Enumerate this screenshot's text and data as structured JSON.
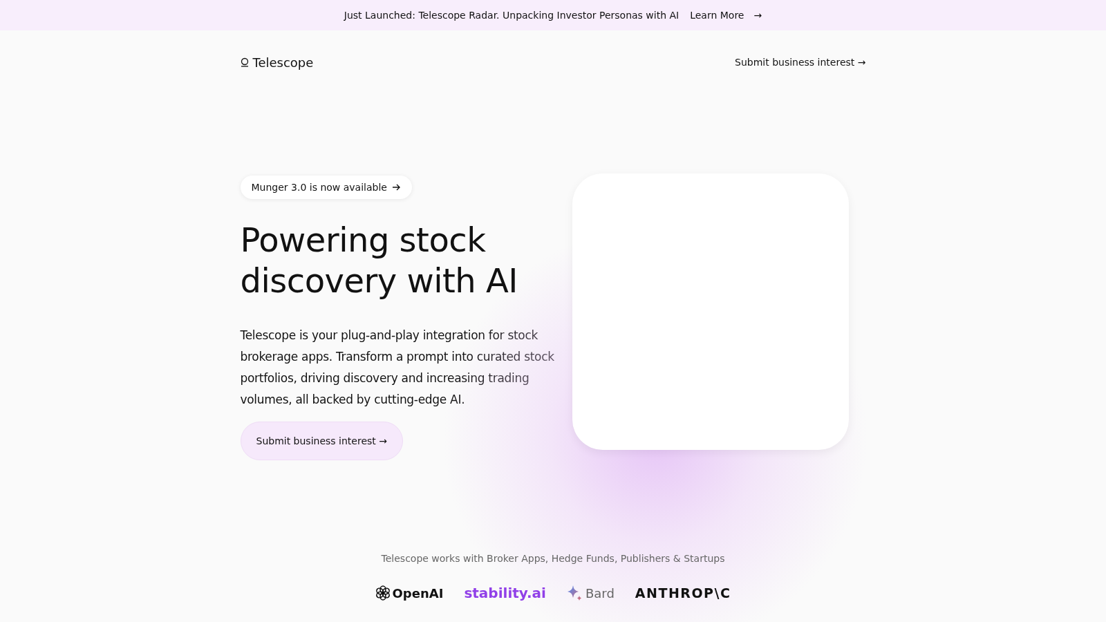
{
  "announcement": {
    "text": "Just Launched: Telescope Radar. Unpacking Investor Personas with AI",
    "link": "Learn More",
    "arrow": "→"
  },
  "nav": {
    "brand": "Telescope",
    "cta": "Submit business interest →"
  },
  "hero": {
    "badge": "Munger 3.0 is now available",
    "title": "Powering stock discovery with AI",
    "description": "Telescope is your plug-and-play integration for stock brokerage apps. Transform a prompt into curated stock portfolios, driving discovery and increasing trading volumes, all backed by cutting-edge AI.",
    "button": "Submit business interest →"
  },
  "partners": {
    "caption": "Telescope works with Broker Apps, Hedge Funds, Publishers & Startups",
    "logos": [
      {
        "kind": "openai",
        "name": "OpenAI"
      },
      {
        "kind": "stability",
        "name": "stability.ai"
      },
      {
        "kind": "bard",
        "name": "Bard"
      },
      {
        "kind": "anthropic",
        "name": "ANTHROP\\C"
      }
    ]
  }
}
